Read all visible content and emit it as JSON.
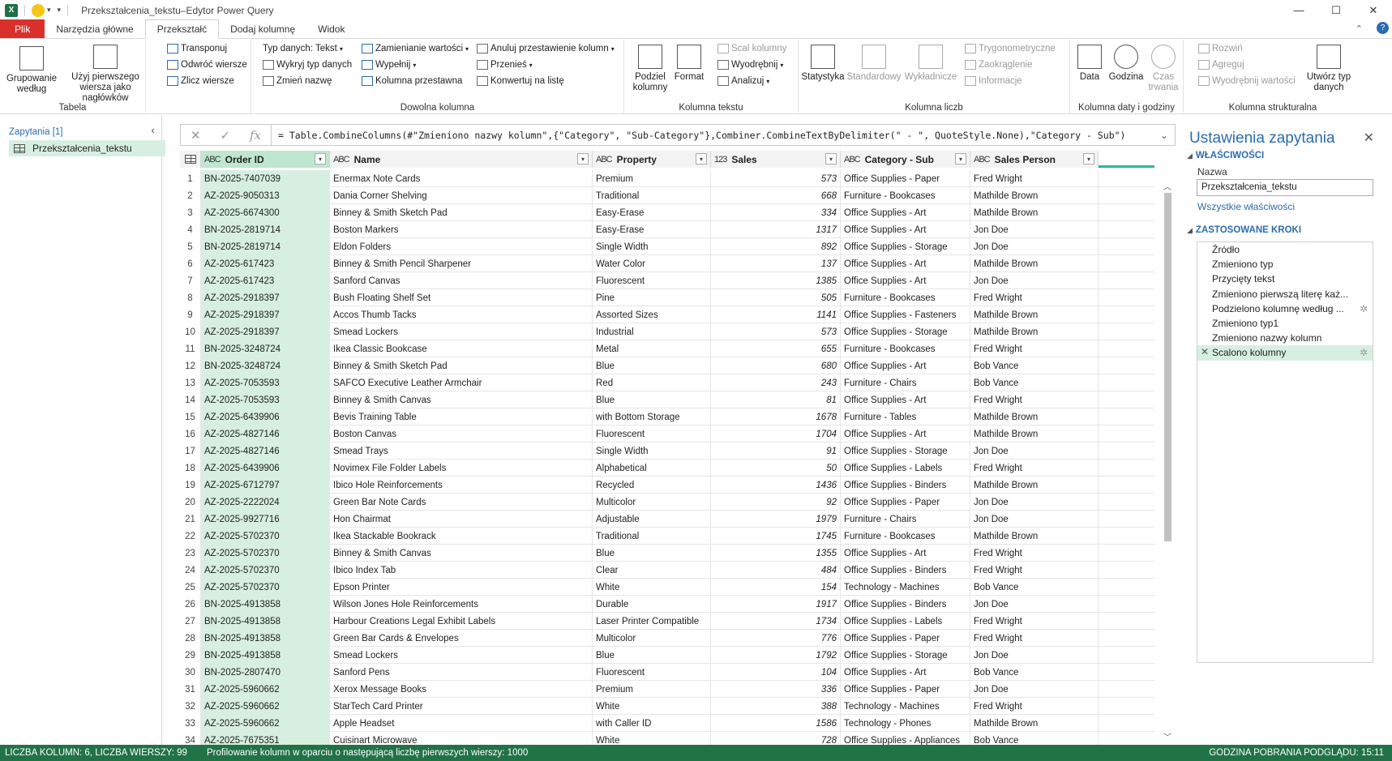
{
  "window": {
    "title": "Przekształcenia_tekstu–Edytor Power Query"
  },
  "tabs": [
    "Plik",
    "Narzędzia główne",
    "Przekształć",
    "Dodaj kolumnę",
    "Widok"
  ],
  "ribbon": {
    "tabela": {
      "name": "Tabela",
      "group_by": "Grupowanie według",
      "use_first_row": "Użyj pierwszego wiersza jako nagłówków",
      "transpose": "Transponuj",
      "reverse_rows": "Odwróć wiersze",
      "count_rows": "Zlicz wiersze"
    },
    "dowolna": {
      "name": "Dowolna kolumna",
      "data_type": "Typ danych: Tekst",
      "detect_type": "Wykryj typ danych",
      "rename": "Zmień nazwę",
      "replace_values": "Zamienianie wartości",
      "fill": "Wypełnij",
      "pivot": "Kolumna przestawna",
      "unpivot": "Anuluj przestawienie kolumn",
      "move": "Przenieś",
      "convert_list": "Konwertuj na listę"
    },
    "tekst": {
      "name": "Kolumna tekstu",
      "split": "Podziel kolumny",
      "format": "Format",
      "merge": "Scal kolumny",
      "extract": "Wyodrębnij",
      "parse": "Analizuj"
    },
    "liczb": {
      "name": "Kolumna liczb",
      "statistics": "Statystyka",
      "standard": "Standardowy",
      "scientific": "Wykładnicze",
      "trig": "Trygonometryczne",
      "rounding": "Zaokrąglenie",
      "information": "Informacje"
    },
    "data": {
      "name": "Kolumna daty i godziny",
      "date": "Data",
      "time": "Godzina",
      "duration": "Czas trwania"
    },
    "struktura": {
      "name": "Kolumna strukturalna",
      "expand": "Rozwiń",
      "aggregate": "Agreguj",
      "extract_values": "Wyodrębnij wartości",
      "create_type": "Utwórz typ danych"
    }
  },
  "queries": {
    "header": "Zapytania [1]",
    "items": [
      "Przekształcenia_tekstu"
    ]
  },
  "formula": "= Table.CombineColumns(#\"Zmieniono nazwy kolumn\",{\"Category\", \"Sub-Category\"},Combiner.CombineTextByDelimiter(\" - \", QuoteStyle.None),\"Category - Sub\")",
  "columns": [
    {
      "type": "ABC",
      "name": "Order ID"
    },
    {
      "type": "ABC",
      "name": "Name"
    },
    {
      "type": "ABC",
      "name": "Property"
    },
    {
      "type": "123",
      "name": "Sales"
    },
    {
      "type": "ABC",
      "name": "Category - Sub"
    },
    {
      "type": "ABC",
      "name": "Sales Person"
    }
  ],
  "rows": [
    [
      "BN-2025-7407039",
      "Enermax Note Cards",
      "Premium",
      "573",
      "Office Supplies - Paper",
      "Fred Wright"
    ],
    [
      "AZ-2025-9050313",
      "Dania Corner Shelving",
      "Traditional",
      "668",
      "Furniture - Bookcases",
      "Mathilde Brown"
    ],
    [
      "AZ-2025-6674300",
      "Binney & Smith Sketch Pad",
      "Easy-Erase",
      "334",
      "Office Supplies - Art",
      "Mathilde Brown"
    ],
    [
      "BN-2025-2819714",
      "Boston Markers",
      "Easy-Erase",
      "1317",
      "Office Supplies - Art",
      "Jon Doe"
    ],
    [
      "BN-2025-2819714",
      "Eldon Folders",
      "Single Width",
      "892",
      "Office Supplies - Storage",
      "Jon Doe"
    ],
    [
      "AZ-2025-617423",
      "Binney & Smith Pencil Sharpener",
      "Water Color",
      "137",
      "Office Supplies - Art",
      "Mathilde Brown"
    ],
    [
      "AZ-2025-617423",
      "Sanford Canvas",
      "Fluorescent",
      "1385",
      "Office Supplies - Art",
      "Jon Doe"
    ],
    [
      "AZ-2025-2918397",
      "Bush Floating Shelf Set",
      "Pine",
      "505",
      "Furniture - Bookcases",
      "Fred Wright"
    ],
    [
      "AZ-2025-2918397",
      "Accos Thumb Tacks",
      "Assorted Sizes",
      "1141",
      "Office Supplies - Fasteners",
      "Mathilde Brown"
    ],
    [
      "AZ-2025-2918397",
      "Smead Lockers",
      "Industrial",
      "573",
      "Office Supplies - Storage",
      "Mathilde Brown"
    ],
    [
      "BN-2025-3248724",
      "Ikea Classic Bookcase",
      "Metal",
      "655",
      "Furniture - Bookcases",
      "Fred Wright"
    ],
    [
      "BN-2025-3248724",
      "Binney & Smith Sketch Pad",
      "Blue",
      "680",
      "Office Supplies - Art",
      "Bob Vance"
    ],
    [
      "AZ-2025-7053593",
      "SAFCO Executive Leather Armchair",
      "Red",
      "243",
      "Furniture - Chairs",
      "Bob Vance"
    ],
    [
      "AZ-2025-7053593",
      "Binney & Smith Canvas",
      "Blue",
      "81",
      "Office Supplies - Art",
      "Fred Wright"
    ],
    [
      "AZ-2025-6439906",
      "Bevis Training Table",
      "with Bottom Storage",
      "1678",
      "Furniture - Tables",
      "Mathilde Brown"
    ],
    [
      "AZ-2025-4827146",
      "Boston Canvas",
      "Fluorescent",
      "1704",
      "Office Supplies - Art",
      "Mathilde Brown"
    ],
    [
      "AZ-2025-4827146",
      "Smead Trays",
      "Single Width",
      "91",
      "Office Supplies - Storage",
      "Jon Doe"
    ],
    [
      "AZ-2025-6439906",
      "Novimex File Folder Labels",
      "Alphabetical",
      "50",
      "Office Supplies - Labels",
      "Fred Wright"
    ],
    [
      "AZ-2025-6712797",
      "Ibico Hole Reinforcements",
      "Recycled",
      "1436",
      "Office Supplies - Binders",
      "Mathilde Brown"
    ],
    [
      "AZ-2025-2222024",
      "Green Bar Note Cards",
      "Multicolor",
      "92",
      "Office Supplies - Paper",
      "Jon Doe"
    ],
    [
      "AZ-2025-9927716",
      "Hon Chairmat",
      "Adjustable",
      "1979",
      "Furniture - Chairs",
      "Jon Doe"
    ],
    [
      "AZ-2025-5702370",
      "Ikea Stackable Bookrack",
      "Traditional",
      "1745",
      "Furniture - Bookcases",
      "Mathilde Brown"
    ],
    [
      "AZ-2025-5702370",
      "Binney & Smith Canvas",
      "Blue",
      "1355",
      "Office Supplies - Art",
      "Fred Wright"
    ],
    [
      "AZ-2025-5702370",
      "Ibico Index Tab",
      "Clear",
      "484",
      "Office Supplies - Binders",
      "Fred Wright"
    ],
    [
      "AZ-2025-5702370",
      "Epson Printer",
      "White",
      "154",
      "Technology - Machines",
      "Bob Vance"
    ],
    [
      "BN-2025-4913858",
      "Wilson Jones Hole Reinforcements",
      "Durable",
      "1917",
      "Office Supplies - Binders",
      "Jon Doe"
    ],
    [
      "BN-2025-4913858",
      "Harbour Creations Legal Exhibit Labels",
      "Laser Printer Compatible",
      "1734",
      "Office Supplies - Labels",
      "Fred Wright"
    ],
    [
      "BN-2025-4913858",
      "Green Bar Cards & Envelopes",
      "Multicolor",
      "776",
      "Office Supplies - Paper",
      "Fred Wright"
    ],
    [
      "BN-2025-4913858",
      "Smead Lockers",
      "Blue",
      "1792",
      "Office Supplies - Storage",
      "Jon Doe"
    ],
    [
      "BN-2025-2807470",
      "Sanford Pens",
      "Fluorescent",
      "104",
      "Office Supplies - Art",
      "Bob Vance"
    ],
    [
      "AZ-2025-5960662",
      "Xerox Message Books",
      "Premium",
      "336",
      "Office Supplies - Paper",
      "Jon Doe"
    ],
    [
      "AZ-2025-5960662",
      "StarTech Card Printer",
      "White",
      "388",
      "Technology - Machines",
      "Fred Wright"
    ],
    [
      "AZ-2025-5960662",
      "Apple Headset",
      "with Caller ID",
      "1586",
      "Technology - Phones",
      "Mathilde Brown"
    ],
    [
      "AZ-2025-7675351",
      "Cuisinart Microwave",
      "White",
      "728",
      "Office Supplies - Appliances",
      "Bob Vance"
    ]
  ],
  "settings": {
    "title": "Ustawienia zapytania",
    "properties_header": "WŁAŚCIWOŚCI",
    "name_label": "Nazwa",
    "name_value": "Przekształcenia_tekstu",
    "all_properties": "Wszystkie właściwości",
    "steps_header": "ZASTOSOWANE KROKI",
    "steps": [
      "Źródło",
      "Zmieniono typ",
      "Przycięty tekst",
      "Zmieniono pierwszą literę każ...",
      "Podzielono kolumnę według ...",
      "Zmieniono typ1",
      "Zmieniono nazwy kolumn",
      "Scalono kolumny"
    ]
  },
  "status": {
    "columns_rows": "LICZBA KOLUMN: 6, LICZBA WIERSZY: 99",
    "profiling": "Profilowanie kolumn w oparciu o następującą liczbę pierwszych wierszy: 1000",
    "preview_time": "GODZINA POBRANIA PODGLĄDU: 15:11"
  }
}
